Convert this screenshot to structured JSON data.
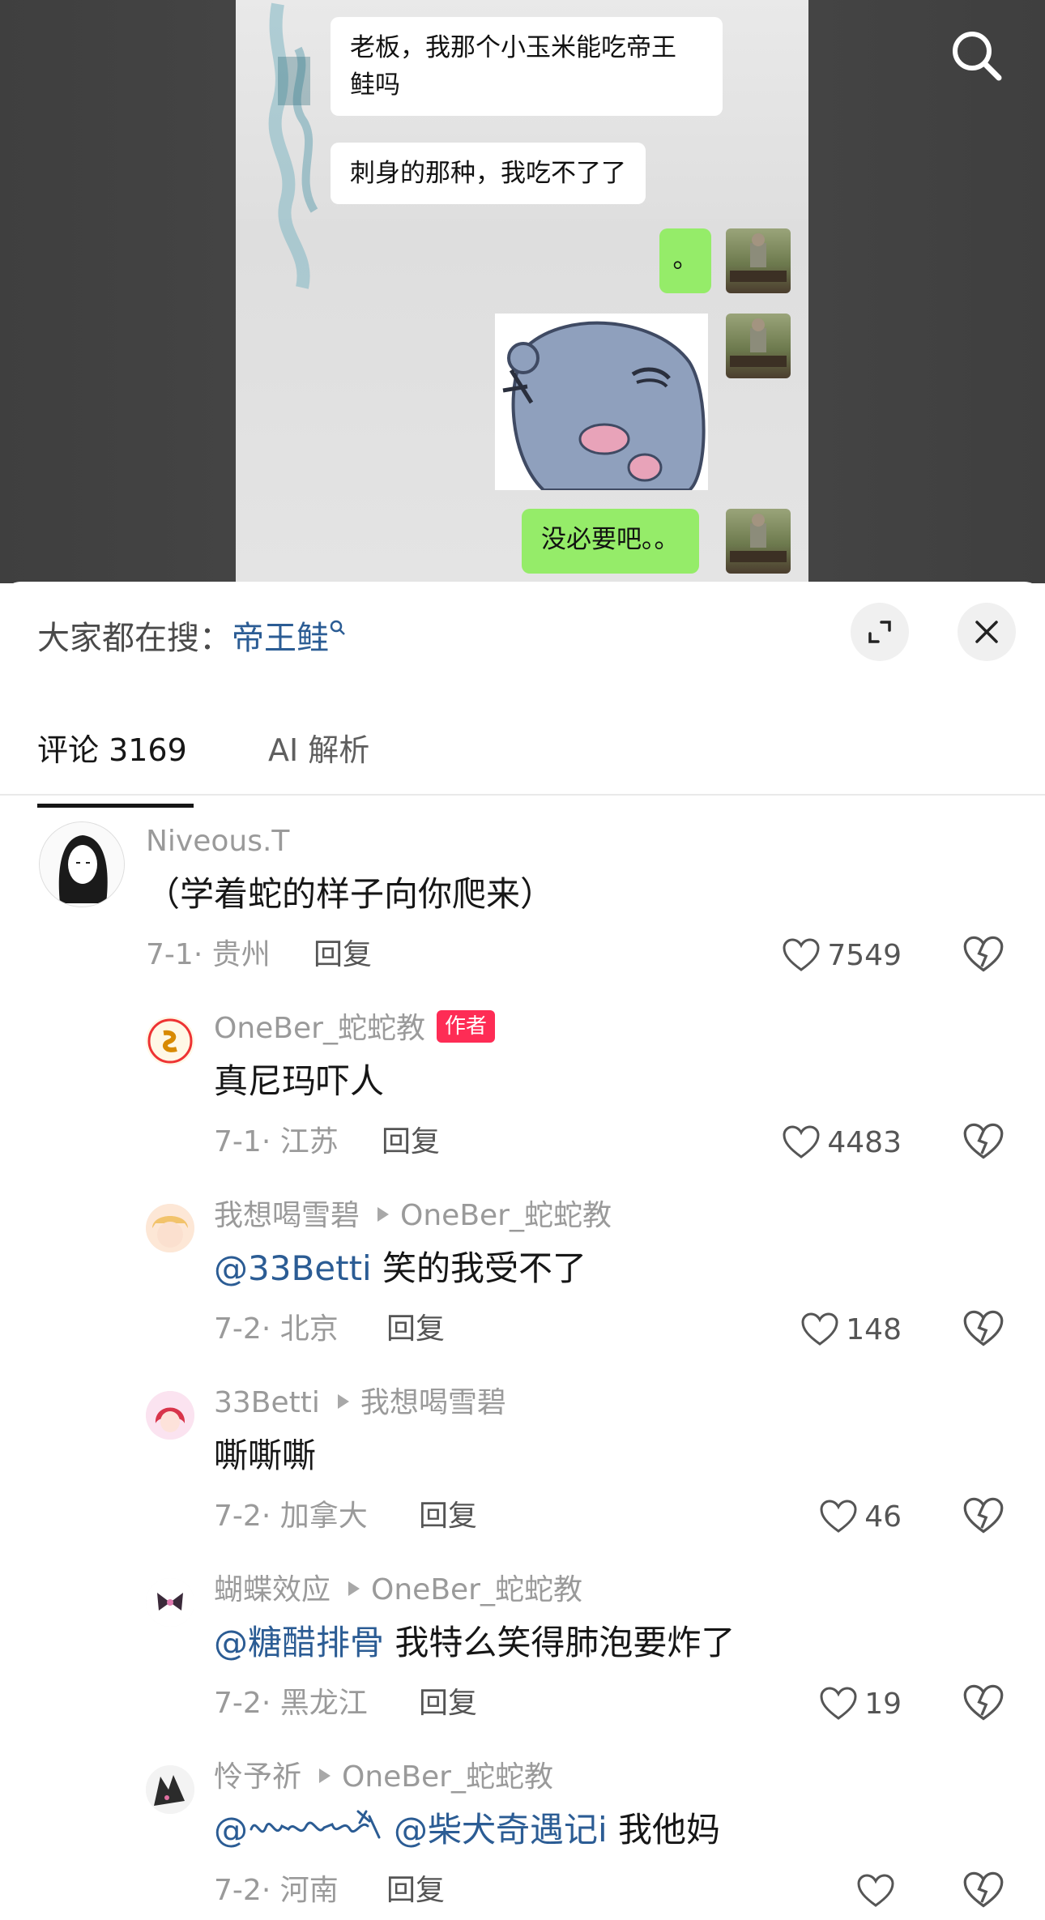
{
  "video": {
    "chat": [
      {
        "side": "left",
        "text": "老板，我那个小玉米能吃帝王\n鲑吗"
      },
      {
        "side": "left",
        "text": "刺身的那种，我吃不了了"
      },
      {
        "side": "right",
        "text": "。"
      },
      {
        "side": "right",
        "text": "没必要吧。。"
      }
    ],
    "search_icon": "search-icon"
  },
  "sheet": {
    "trending_label": "大家都在搜：",
    "trending_keyword": "帝王鲑",
    "expand_icon": "expand-icon",
    "close_icon": "close-icon",
    "tabs": [
      {
        "label": "评论 3169",
        "active": true
      },
      {
        "label": "AI 解析",
        "active": false
      }
    ]
  },
  "comments": [
    {
      "user": "Niveous.T",
      "text": "（学着蛇的样子向你爬来）",
      "date": "7-1",
      "location": "贵州",
      "reply": "回复",
      "likes": "7549"
    },
    {
      "user": "OneBer_蛇蛇教",
      "badge": "作者",
      "text": "真尼玛吓人",
      "date": "7-1",
      "location": "江苏",
      "reply": "回复",
      "likes": "4483"
    },
    {
      "user": "我想喝雪碧",
      "reply_to": "OneBer_蛇蛇教",
      "mention": "@33Betti",
      "text": " 笑的我受不了",
      "date": "7-2",
      "location": "北京",
      "reply": "回复",
      "likes": "148"
    },
    {
      "user": "33Betti",
      "reply_to": "我想喝雪碧",
      "text": "嘶嘶嘶",
      "date": "7-2",
      "location": "加拿大",
      "reply": "回复",
      "likes": "46"
    },
    {
      "user": "蝴蝶效应",
      "reply_to": "OneBer_蛇蛇教",
      "mention": "@糖醋排骨",
      "text": " 我特么笑得肺泡要炸了",
      "date": "7-2",
      "location": "黑龙江",
      "reply": "回复",
      "likes": "19"
    },
    {
      "user": "怜予祈",
      "reply_to": "OneBer_蛇蛇教",
      "mention": "@",
      "mention2": "@柴犬奇遇记i",
      "text": " 我他妈",
      "date": "7-2",
      "location": "河南",
      "reply": "回复",
      "likes": ""
    }
  ],
  "colors": {
    "link": "#2b5c94",
    "badge": "#fe2c55",
    "chat_green": "#95ec69"
  }
}
